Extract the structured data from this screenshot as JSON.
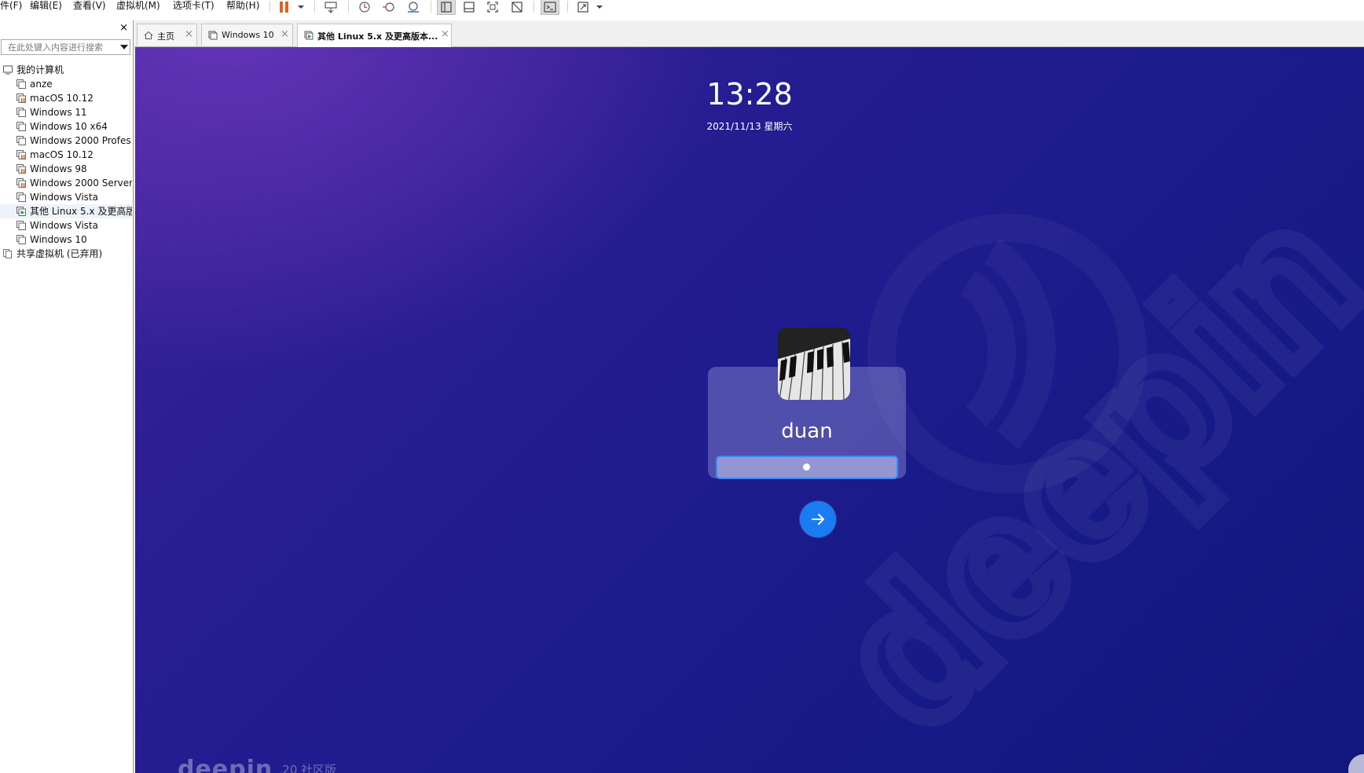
{
  "menubar": {
    "items": [
      "件(F)",
      "编辑(E)",
      "查看(V)",
      "虚拟机(M)",
      "选项卡(T)",
      "帮助(H)"
    ]
  },
  "toolbar": {
    "icons": [
      "pause-icon",
      "dropdown-icon",
      "send-keys-icon",
      "snapshot-icon",
      "revert-snapshot-icon",
      "snapshot-manager-icon",
      "library-view-icon",
      "thumbnail-bar-icon",
      "fullscreen-icon",
      "unity-icon",
      "console-icon",
      "stretch-icon"
    ],
    "accent_color": "#e85d1f"
  },
  "sidebar": {
    "close": "×",
    "search_placeholder": "在此处键入内容进行搜索",
    "tree": [
      {
        "label": "我的计算机",
        "kind": "group"
      },
      {
        "label": "anze",
        "kind": "vm"
      },
      {
        "label": "macOS 10.12",
        "kind": "vm-paused"
      },
      {
        "label": "Windows 11",
        "kind": "vm"
      },
      {
        "label": "Windows 10 x64",
        "kind": "vm"
      },
      {
        "label": "Windows 2000 Profes",
        "kind": "vm"
      },
      {
        "label": "macOS 10.12",
        "kind": "vm-paused"
      },
      {
        "label": "Windows 98",
        "kind": "vm-paused"
      },
      {
        "label": "Windows 2000 Server",
        "kind": "vm-paused"
      },
      {
        "label": "Windows Vista",
        "kind": "vm"
      },
      {
        "label": "其他 Linux 5.x 及更高版",
        "kind": "vm-running"
      },
      {
        "label": "Windows Vista",
        "kind": "vm"
      },
      {
        "label": "Windows 10",
        "kind": "vm"
      },
      {
        "label": "共享虚拟机 (已弃用)",
        "kind": "shared"
      }
    ]
  },
  "tabs": [
    {
      "label": "主页",
      "icon": "home-icon",
      "close": "×"
    },
    {
      "label": "Windows 10",
      "icon": "vm-icon",
      "close": "×"
    },
    {
      "label": "其他 Linux 5.x 及更高版本...",
      "icon": "vm-running-icon",
      "close": "×",
      "active": true
    }
  ],
  "vm_screen": {
    "time": "13:28",
    "date": "2021/11/13 星期六",
    "username": "duan",
    "password_masked": "•",
    "submit_icon": "arrow-right-icon",
    "brand": "deepin",
    "edition": "20 社区版",
    "watermark": "deepin",
    "colors": {
      "background_top": "#3a2398",
      "background_bottom": "#12177d",
      "focus_border": "#3b8cff",
      "login_button": "#1a7cf2"
    }
  }
}
